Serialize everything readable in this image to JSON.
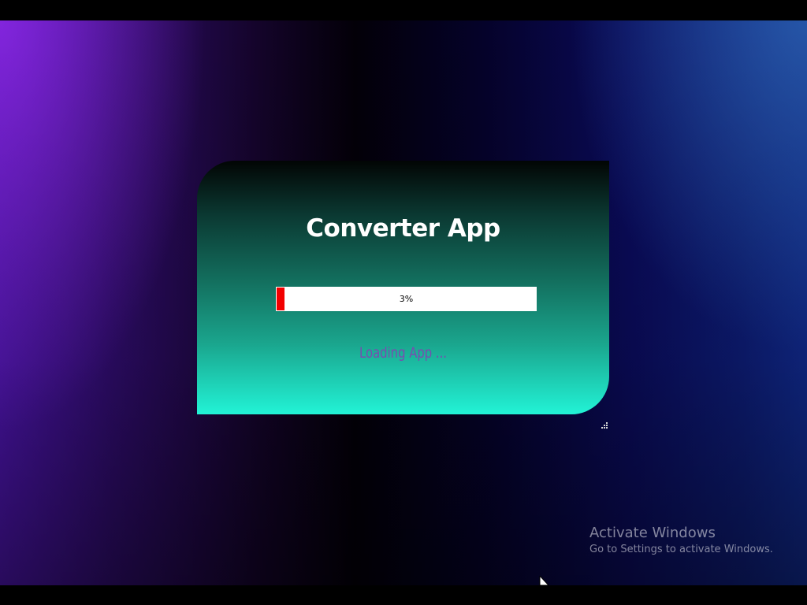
{
  "splash": {
    "title": "Converter App",
    "progress": {
      "percent": 3,
      "label": "3%"
    },
    "status": "Loading App ..."
  },
  "watermark": {
    "title": "Activate Windows",
    "subtitle": "Go to Settings to activate Windows."
  },
  "colors": {
    "progress_fill": "#f20000",
    "progress_track": "#ffffff",
    "title_text": "#ffffff",
    "status_text": "#7a4bb0",
    "window_gradient_top": "#020504",
    "window_gradient_bottom": "#22f3d6"
  },
  "icons": {
    "resize_grip": "resize-grip-icon",
    "cursor": "mouse-cursor-icon"
  }
}
